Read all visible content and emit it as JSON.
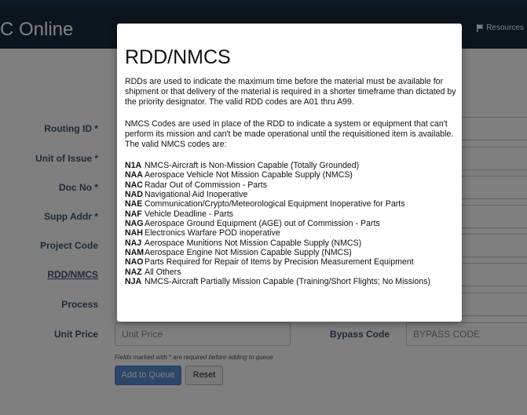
{
  "header": {
    "brand": "C Online",
    "resources_label": "Resources"
  },
  "form": {
    "labels": {
      "routing_id": "Routing ID *",
      "unit_of_issue": "Unit of Issue *",
      "doc_no": "Doc No *",
      "supp_addr": "Supp Addr *",
      "project_code": "Project Code",
      "rdd_nmcs": "RDD/NMCS",
      "process": "Process",
      "unit_price": "Unit Price",
      "bypass_code": "Bypass Code"
    },
    "unit_price_placeholder": "Unit Price",
    "bypass_code_placeholder": "BYPASS CODE",
    "required_hint": "Fields marked with * are required before adding to queue",
    "add_button": "Add to Queue",
    "reset_button": "Reset"
  },
  "modal": {
    "title": "RDD/NMCS",
    "rdd_description": "RDDs are used to indicate the maximum time before the material must be available for shipment or that delivery of the material is required in a shorter timeframe than dictated by the priority designator. The valid RDD codes are A01 thru A99.",
    "nmcs_description": "NMCS Codes are used in place of the RDD to indicate a system or equipment that can't perform its mission and can't be made operational until the requisitioned item is available. The valid NMCS codes are:",
    "codes": [
      {
        "code": "N1A",
        "desc": "NMCS-Aircraft is Non-Mission Capable (Totally Grounded)"
      },
      {
        "code": "NAA",
        "desc": "Aerospace Vehicle Not Mission Capable Supply (NMCS)"
      },
      {
        "code": "NAC",
        "desc": "Radar Out of Commission - Parts"
      },
      {
        "code": "NAD",
        "desc": "Navigational Aid Inoperative"
      },
      {
        "code": "NAE",
        "desc": "Communication/Crypto/Meteorological Equipment Inoperative for Parts"
      },
      {
        "code": "NAF",
        "desc": "Vehicle Deadline - Parts"
      },
      {
        "code": "NAG",
        "desc": "Aerospace Ground Equipment (AGE) out of Commission - Parts"
      },
      {
        "code": "NAH",
        "desc": "Electronics Warfare POD inoperative"
      },
      {
        "code": "NAJ",
        "desc": "Aerospace Munitions Not Mission Capable Supply (NMCS)"
      },
      {
        "code": "NAM",
        "desc": "Aerospace Engine Not Mission Capable Supply (NMCS)"
      },
      {
        "code": "NAO",
        "desc": "Parts Required for Repair of Items by Precision Measurement Equipment"
      },
      {
        "code": "NAZ",
        "desc": "All Others"
      },
      {
        "code": "NJA",
        "desc": "NMCS-Aircraft Partially Mission Capable (Training/Short Flights; No Missions)"
      }
    ]
  }
}
